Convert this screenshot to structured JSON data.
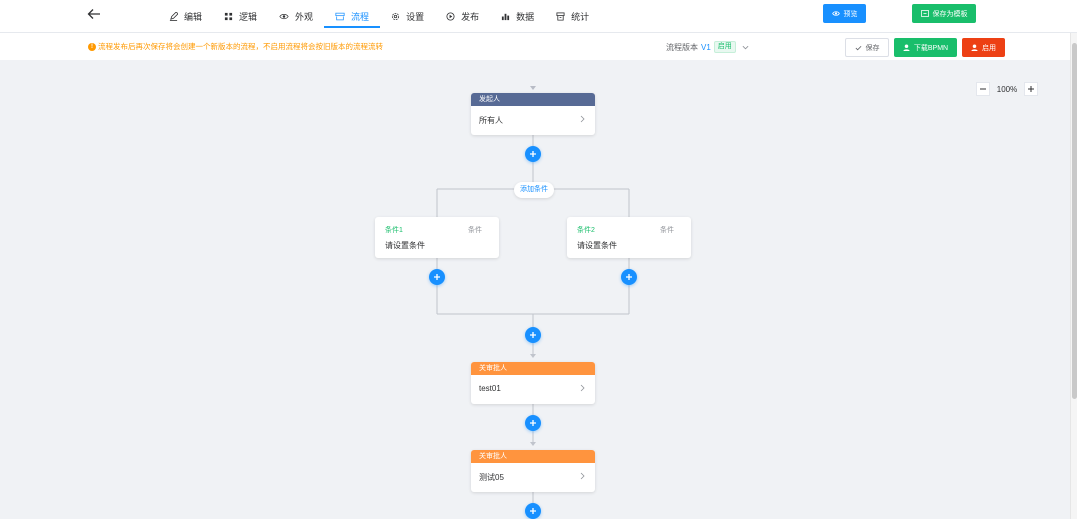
{
  "toolbar": {
    "tabs": [
      {
        "label": "编辑",
        "icon": "edit-icon"
      },
      {
        "label": "逻辑",
        "icon": "logic-icon"
      },
      {
        "label": "外观",
        "icon": "eye-icon"
      },
      {
        "label": "流程",
        "icon": "flow-icon"
      },
      {
        "label": "设置",
        "icon": "gear-icon"
      },
      {
        "label": "发布",
        "icon": "publish-icon"
      },
      {
        "label": "数据",
        "icon": "bar-chart-icon"
      },
      {
        "label": "统计",
        "icon": "stats-icon"
      }
    ],
    "active_tab": "流程",
    "preview_label": "预览",
    "save_template_label": "保存为模板"
  },
  "info": {
    "warning": "流程发布后再次保存将会创建一个新版本的流程，不启用流程将会按旧版本的流程流转",
    "version_label": "流程版本",
    "version_value": "V1",
    "version_status": "启用",
    "save_label": "保存",
    "download_label": "下载BPMN",
    "enable_label": "启用"
  },
  "zoom": {
    "value": "100%"
  },
  "flow": {
    "start": {
      "header": "发起人",
      "content": "所有人"
    },
    "add_condition_label": "添加条件",
    "conditions": [
      {
        "title": "条件1",
        "priority": "条件",
        "text": "请设置条件"
      },
      {
        "title": "条件2",
        "priority": "条件",
        "text": "请设置条件"
      }
    ],
    "approvers": [
      {
        "header": "关审批人",
        "content": "test01"
      },
      {
        "header": "关审批人",
        "content": "测试05"
      }
    ]
  },
  "colors": {
    "primary": "#1890ff",
    "success": "#19be6b",
    "danger": "#ed4014",
    "warning": "#ff9900",
    "start_header": "#576a95",
    "approver_header": "#ff943e"
  }
}
